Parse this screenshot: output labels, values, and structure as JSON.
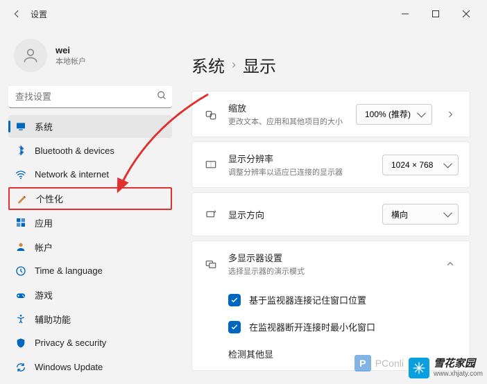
{
  "titlebar": {
    "title": "设置"
  },
  "user": {
    "name": "wei",
    "sub": "本地帐户"
  },
  "search": {
    "placeholder": "查找设置"
  },
  "nav": [
    {
      "id": "system",
      "label": "系统",
      "active": true
    },
    {
      "id": "bluetooth",
      "label": "Bluetooth & devices"
    },
    {
      "id": "network",
      "label": "Network & internet"
    },
    {
      "id": "personalization",
      "label": "个性化",
      "highlight": true
    },
    {
      "id": "apps",
      "label": "应用"
    },
    {
      "id": "accounts",
      "label": "帐户"
    },
    {
      "id": "time",
      "label": "Time & language"
    },
    {
      "id": "gaming",
      "label": "游戏"
    },
    {
      "id": "accessibility",
      "label": "辅助功能"
    },
    {
      "id": "privacy",
      "label": "Privacy & security"
    },
    {
      "id": "update",
      "label": "Windows Update"
    }
  ],
  "breadcrumb": {
    "parent": "系统",
    "current": "显示"
  },
  "rows": {
    "scale": {
      "label": "缩放",
      "desc": "更改文本、应用和其他项目的大小",
      "value": "100% (推荐)"
    },
    "resolution": {
      "label": "显示分辨率",
      "desc": "调整分辨率以适应已连接的显示器",
      "value": "1024 × 768"
    },
    "orientation": {
      "label": "显示方向",
      "value": "横向"
    },
    "multi": {
      "label": "多显示器设置",
      "desc": "选择显示器的演示模式"
    },
    "remember": {
      "label": "基于监视器连接记住窗口位置"
    },
    "minimize": {
      "label": "在监视器断开连接时最小化窗口"
    },
    "detect": {
      "label": "检测其他显"
    }
  },
  "watermark": {
    "title": "雪花家园",
    "url": "www.xhjaty.com"
  },
  "pconline": {
    "text": "PConli"
  }
}
